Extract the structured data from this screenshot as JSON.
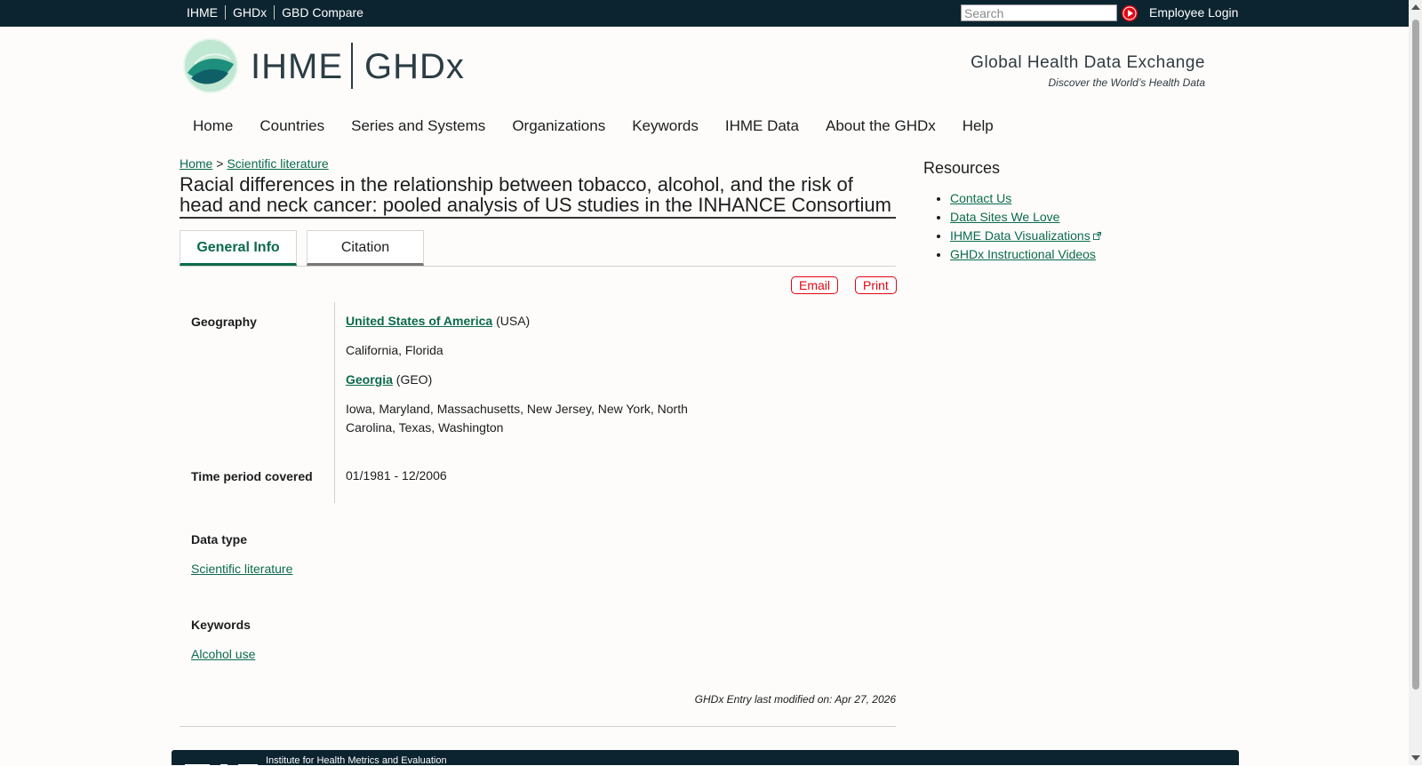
{
  "topbar": {
    "links": [
      "IHME",
      "GHDx",
      "GBD Compare"
    ],
    "search_placeholder": "Search",
    "employee_login": "Employee Login"
  },
  "header": {
    "logo_ihme": "IHME",
    "logo_ghdx": "GHDx",
    "tagline_title": "Global Health Data Exchange",
    "tagline_sub": "Discover the World’s Health Data"
  },
  "nav": [
    "Home",
    "Countries",
    "Series and Systems",
    "Organizations",
    "Keywords",
    "IHME Data",
    "About the GHDx",
    "Help"
  ],
  "breadcrumb": {
    "home": "Home",
    "sep": ">",
    "current": "Scientific literature"
  },
  "page_title": "Racial differences in the relationship between tobacco, alcohol, and the risk of head and neck cancer: pooled analysis of US studies in the INHANCE Consortium",
  "tabs": {
    "general": "General Info",
    "citation": "Citation"
  },
  "actions": {
    "email": "Email",
    "print": "Print"
  },
  "info": {
    "geography_label": "Geography",
    "geo1_link": "United States of America",
    "geo1_code": "(USA)",
    "geo1_states": "California, Florida",
    "geo2_link": "Georgia",
    "geo2_code": "(GEO)",
    "geo2_states": "Iowa, Maryland, Massachusetts, New Jersey, New York, North Carolina, Texas, Washington",
    "time_label": "Time period covered",
    "time_value": "01/1981 - 12/2006"
  },
  "data_type": {
    "label": "Data type",
    "link": "Scientific literature"
  },
  "keywords": {
    "label": "Keywords",
    "link": "Alcohol use"
  },
  "last_modified": "GHDx Entry last modified on: Apr 27, 2026",
  "sidebar": {
    "title": "Resources",
    "items": [
      "Contact Us",
      "Data Sites We Love",
      "IHME Data Visualizations",
      "GHDx Instructional Videos"
    ]
  },
  "footer": {
    "org": "Institute for Health Metrics and Evaluation"
  },
  "colors": {
    "topbar": "#0c2430",
    "link": "#0b6b4b",
    "accent_red": "#e20613"
  },
  "icons": [
    "search-go-icon",
    "ihme-globe-icon",
    "external-link-icon"
  ]
}
